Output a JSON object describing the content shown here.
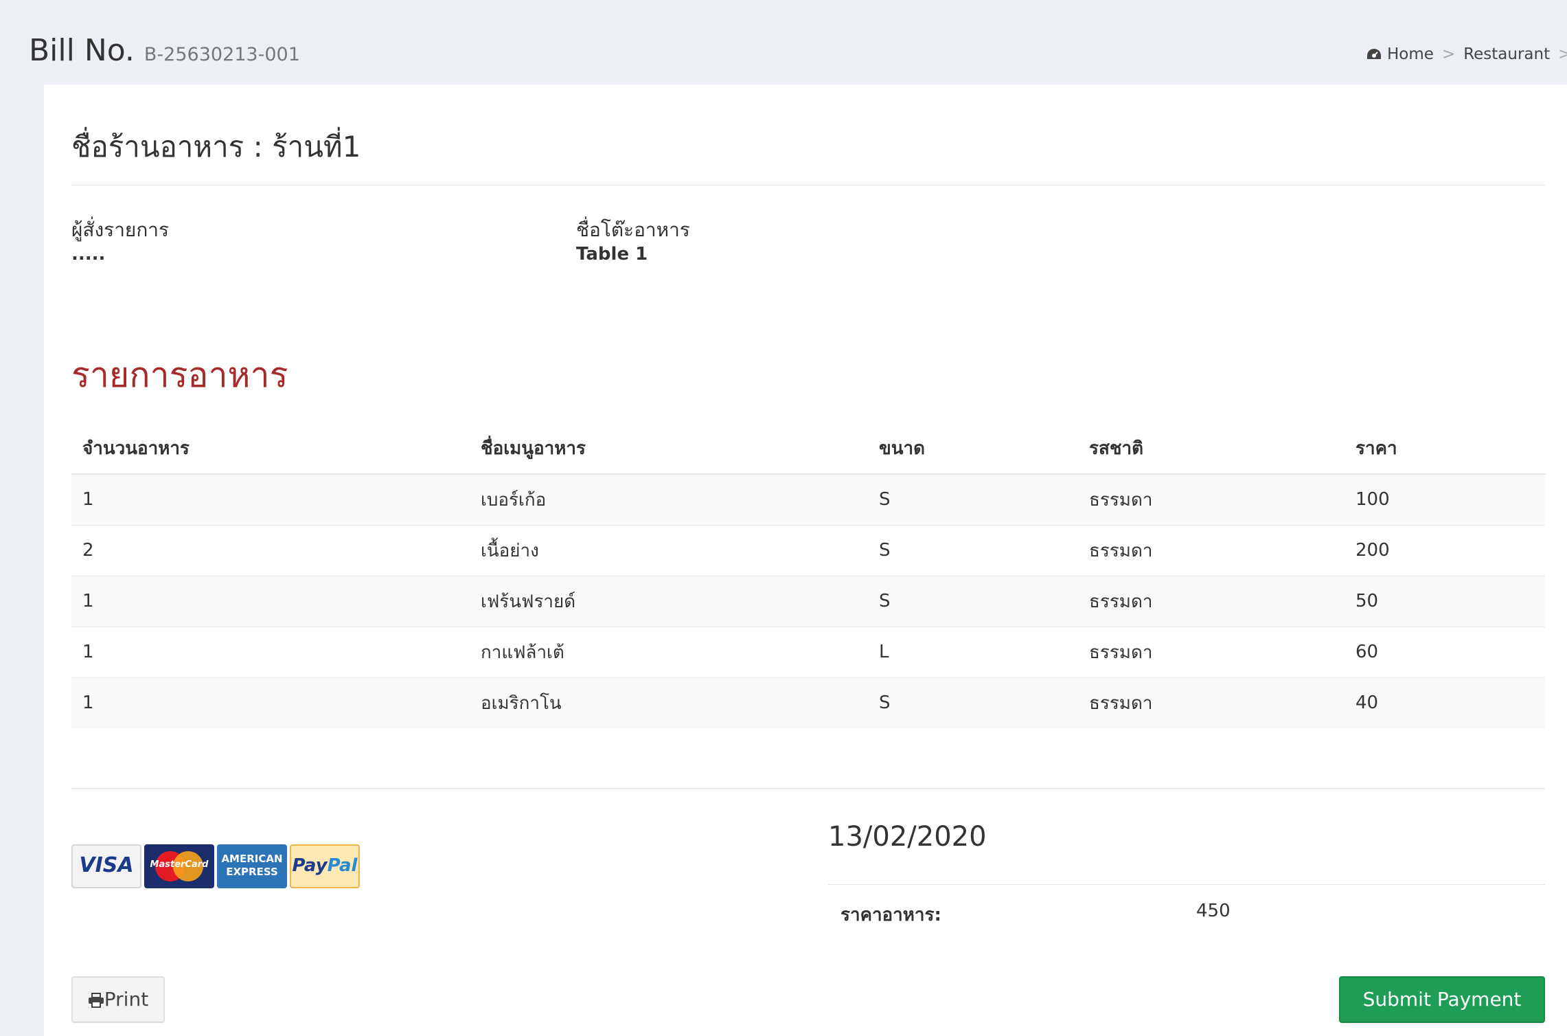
{
  "header": {
    "title": "Bill No.",
    "bill_number": "B-25630213-001",
    "breadcrumb": [
      "Home",
      "Restaurant"
    ]
  },
  "restaurant": {
    "title": "ชื่อร้านอาหาร : ร้านที่1"
  },
  "info": {
    "orderer_label": "ผู้สั่งรายการ",
    "orderer_value": ".....",
    "table_label": "ชื่อโต๊ะอาหาร",
    "table_value": "Table 1"
  },
  "items": {
    "title": "รายการอาหาร",
    "columns": [
      "จำนวนอาหาร",
      "ชื่อเมนูอาหาร",
      "ขนาด",
      "รสชาติ",
      "ราคา"
    ],
    "rows": [
      [
        "1",
        "เบอร์เก้อ",
        "S",
        "ธรรมดา",
        "100"
      ],
      [
        "2",
        "เนื้อย่าง",
        "S",
        "ธรรมดา",
        "200"
      ],
      [
        "1",
        "เฟร้นฟรายด์",
        "S",
        "ธรรมดา",
        "50"
      ],
      [
        "1",
        "กาแฟล้าเต้",
        "L",
        "ธรรมดา",
        "60"
      ],
      [
        "1",
        "อเมริกาโน",
        "S",
        "ธรรมดา",
        "40"
      ]
    ]
  },
  "payment": {
    "cards": [
      {
        "name": "visa-card-icon",
        "text": "VISA"
      },
      {
        "name": "mastercard-card-icon",
        "text": "MasterCard"
      },
      {
        "name": "amex-card-icon",
        "text_top": "AMERICAN",
        "text_bottom": "EXPRESS"
      },
      {
        "name": "paypal-card-icon",
        "text_pay": "Pay",
        "text_pal": "Pal"
      }
    ],
    "date": "13/02/2020",
    "total_label": "ราคาอาหาร:",
    "total_value": "450"
  },
  "actions": {
    "print_label": "Print",
    "submit_label": "Submit Payment"
  },
  "colors": {
    "section_title": "#a52a2a",
    "submit_button": "#1e9e55",
    "background": "#ecf0f5"
  }
}
